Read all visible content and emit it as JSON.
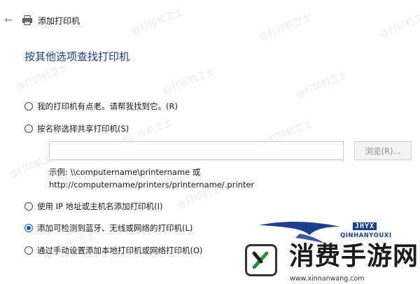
{
  "window": {
    "back_icon": "back-arrow-icon",
    "app_icon": "printer-icon",
    "title": "添加打印机"
  },
  "heading": "按其他选项查找打印机",
  "options": [
    {
      "label": "我的打印机有点老。请帮我找到它。(R)",
      "checked": false
    },
    {
      "label": "按名称选择共享打印机(S)",
      "checked": false
    },
    {
      "label": "使用 IP 地址或主机名添加打印机(I)",
      "checked": false
    },
    {
      "label": "添加可检测到蓝牙、无线或网络的打印机(L)",
      "checked": true
    },
    {
      "label": "通过手动设置添加本地打印机或网络打印机(O)",
      "checked": false
    }
  ],
  "shared_printer": {
    "value": "",
    "browse_label": "浏览(R)...",
    "example_line1": "示例: \\\\computername\\printername 或",
    "example_line2": "http://computername/printers/printername/.printer"
  },
  "watermark_text": "@打印机卫士",
  "brand": {
    "name": "消费手游网",
    "tag": "JHYX",
    "sub": "QINHANYOUXI",
    "url": "www.xinnanwang.com",
    "color": "#1b3f8b"
  },
  "colors": {
    "heading": "#1f3d8a",
    "radio_selected": "#0b5cc9"
  }
}
